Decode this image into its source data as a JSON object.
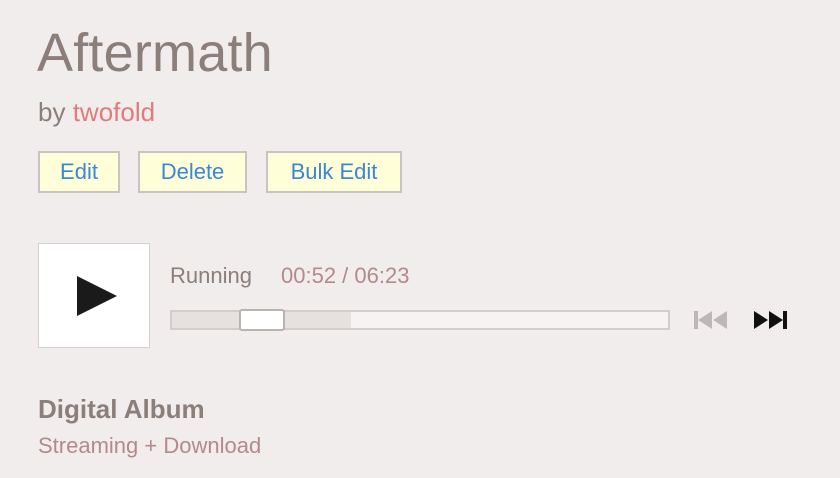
{
  "album": {
    "title": "Aftermath",
    "by_prefix": "by",
    "artist": "twofold"
  },
  "actions": {
    "edit_label": "Edit",
    "delete_label": "Delete",
    "bulk_edit_label": "Bulk Edit"
  },
  "player": {
    "play_icon": "play-icon",
    "track_title": "Running",
    "time_display": "00:52 / 06:23",
    "progress_fraction": 0.136,
    "buffered_fraction": 0.36,
    "prev_icon": "skip-previous-icon",
    "next_icon": "skip-next-icon"
  },
  "format": {
    "title": "Digital Album",
    "subtitle": "Streaming + Download"
  },
  "colors": {
    "background": "#f2eded",
    "text": "#8c7e78",
    "artist_link": "#e07b7b",
    "button_bg": "#fefed8",
    "button_text": "#3a87d6",
    "muted_text": "#b38a8a"
  }
}
